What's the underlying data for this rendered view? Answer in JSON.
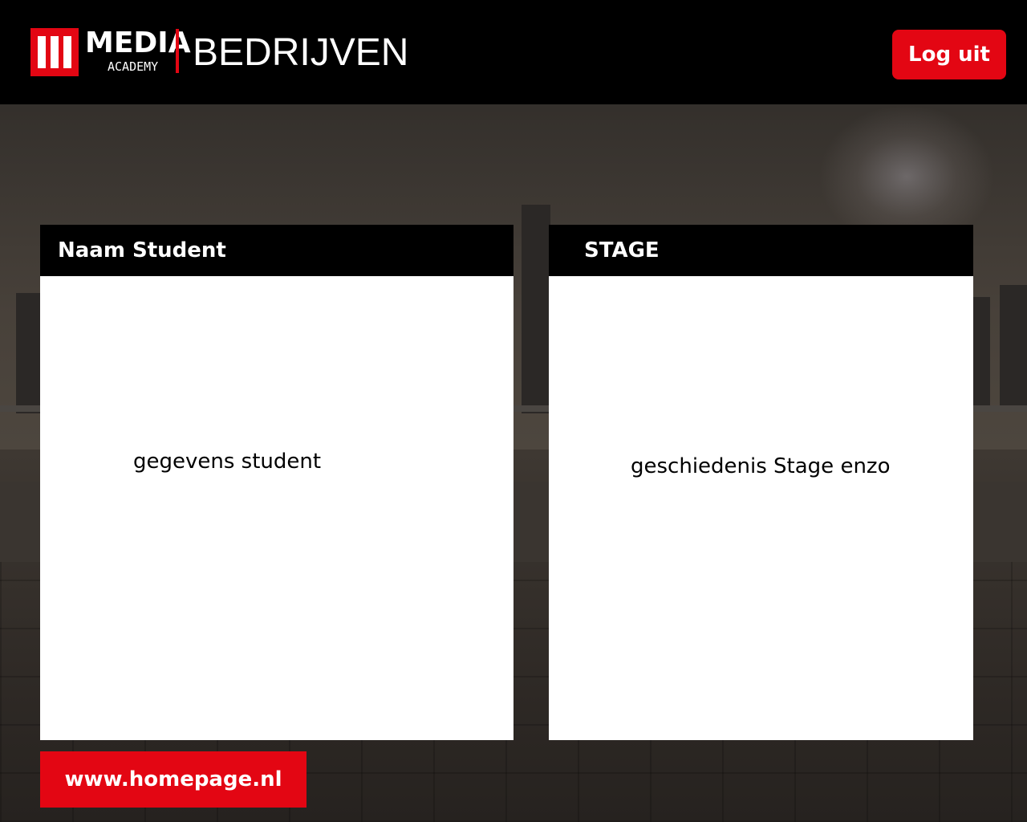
{
  "header": {
    "logo": {
      "brand": "MEDIA",
      "sub": "ACADEMY"
    },
    "title": "BEDRIJVEN",
    "logout_label": "Log uit"
  },
  "panels": {
    "student": {
      "title": "Naam Student",
      "body": "gegevens student"
    },
    "stage": {
      "title": "STAGE",
      "body": "geschiedenis Stage enzo"
    }
  },
  "footer": {
    "link_label": "www.homepage.nl"
  },
  "colors": {
    "accent": "#e30613",
    "header_bg": "#000000",
    "panel_bg": "#ffffff"
  }
}
